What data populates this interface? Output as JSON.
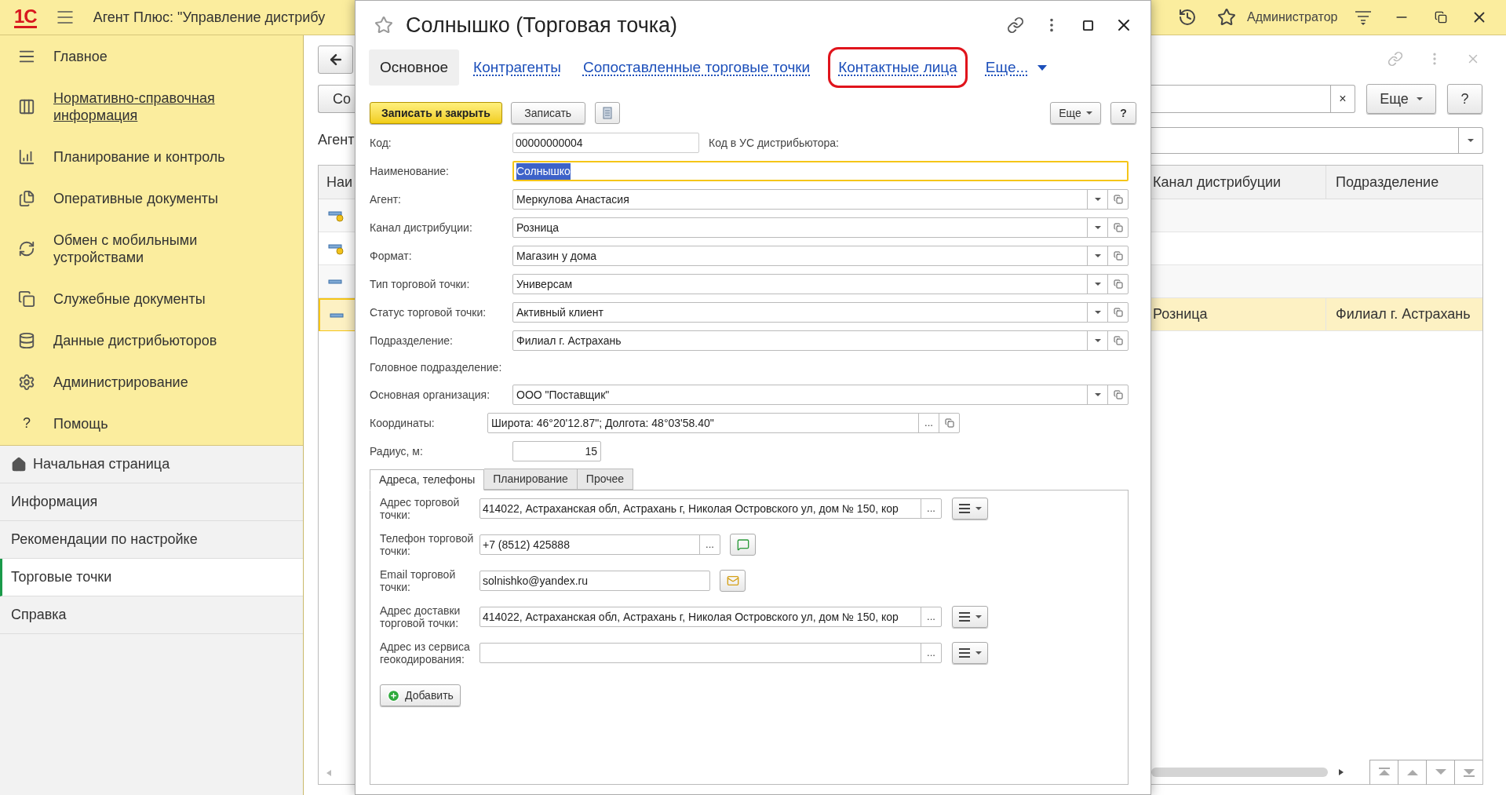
{
  "app": {
    "logo": "1С",
    "title": "Агент Плюс: \"Управление дистрибу",
    "user": "Администратор"
  },
  "sidebar": {
    "sections": [
      {
        "label": "Главное",
        "hovered": false
      },
      {
        "label": "Нормативно-справочная информация",
        "hovered": true
      },
      {
        "label": "Планирование и контроль",
        "hovered": false
      },
      {
        "label": "Оперативные документы",
        "hovered": false
      },
      {
        "label": "Обмен с мобильными устройствами",
        "hovered": false
      },
      {
        "label": "Служебные документы",
        "hovered": false
      },
      {
        "label": "Данные дистрибьюторов",
        "hovered": false
      },
      {
        "label": "Администрирование",
        "hovered": false
      },
      {
        "label": "Помощь",
        "hovered": false,
        "glyph": "?"
      }
    ],
    "items": [
      {
        "kind": "home",
        "label": "Начальная страница",
        "selected": false
      },
      {
        "kind": "page",
        "label": "Информация",
        "selected": false
      },
      {
        "kind": "page",
        "label": "Рекомендации по настройке",
        "selected": false
      },
      {
        "kind": "page",
        "label": "Торговые точки",
        "selected": true
      },
      {
        "kind": "page",
        "label": "Справка",
        "selected": false
      }
    ]
  },
  "list": {
    "create_button": "Со",
    "agent_label": "Агент",
    "search_clear": "×",
    "more_button": "Еще",
    "help_button": "?",
    "columns": [
      "Наи",
      "Канал дистрибуции",
      "Подразделение"
    ],
    "rows": [
      {
        "kind": "marked",
        "selected": false
      },
      {
        "kind": "marked",
        "selected": false
      },
      {
        "kind": "plain",
        "selected": false
      },
      {
        "kind": "plain",
        "selected": true,
        "cells": [
          "Розница",
          "Филиал г. Астрахань"
        ]
      }
    ]
  },
  "form": {
    "title": "Солнышко (Торговая точка)",
    "nav": [
      {
        "label": "Основное",
        "selected": true,
        "highlighted": false
      },
      {
        "label": "Контрагенты",
        "selected": false,
        "highlighted": false
      },
      {
        "label": "Сопоставленные торговые точки",
        "selected": false,
        "highlighted": false
      },
      {
        "label": "Контактные лица",
        "selected": false,
        "highlighted": true
      },
      {
        "label": "Еще...",
        "selected": false,
        "highlighted": false
      }
    ],
    "commands": {
      "primary": "Записать и закрыть",
      "save": "Записать",
      "more": "Еще",
      "help": "?"
    },
    "fields": [
      {
        "kind": "code",
        "label": "Код:",
        "value": "00000000004",
        "side_label": "Код в УС дистрибьютора:",
        "focused": false
      },
      {
        "kind": "text",
        "label": "Наименование:",
        "value": "Солнышко",
        "focused": true
      },
      {
        "kind": "select",
        "label": "Агент:",
        "value": "Меркулова Анастасия"
      },
      {
        "kind": "select",
        "label": "Канал дистрибуции:",
        "value": "Розница"
      },
      {
        "kind": "select",
        "label": "Формат:",
        "value": "Магазин у дома"
      },
      {
        "kind": "select",
        "label": "Тип торговой точки:",
        "value": "Универсам"
      },
      {
        "kind": "select",
        "label": "Статус торговой точки:",
        "value": "Активный клиент"
      },
      {
        "kind": "select",
        "label": "Подразделение:",
        "value": "Филиал г. Астрахань"
      },
      {
        "kind": "heading",
        "label": "Головное подразделение:"
      },
      {
        "kind": "select",
        "label": "Основная организация:",
        "value": "ООО \"Поставщик\""
      },
      {
        "kind": "picker",
        "label": "Координаты:",
        "value": "Широта: 46°20'12.87\"; Долгота: 48°03'58.40\"",
        "button": "..."
      },
      {
        "kind": "number",
        "label": "Радиус, м:",
        "value": "15"
      }
    ],
    "subtabs": [
      {
        "label": "Адреса, телефоны",
        "selected": true
      },
      {
        "label": "Планирование",
        "selected": false
      },
      {
        "label": "Прочее",
        "selected": false
      }
    ],
    "contacts": [
      {
        "kind": "address",
        "label": "Адрес торговой точки:",
        "value": "414022, Астраханская обл, Астрахань г, Николая Островского ул, дом № 150, кор",
        "button": "..."
      },
      {
        "kind": "phone",
        "label": "Телефон торговой точки:",
        "value": "+7 (8512) 425888",
        "button": "..."
      },
      {
        "kind": "email",
        "label": "Email торговой точки:",
        "value": "solnishko@yandex.ru"
      },
      {
        "kind": "address",
        "label": "Адрес доставки торговой точки:",
        "value": "414022, Астраханская обл, Астрахань г, Николая Островского ул, дом № 150, кор",
        "button": "..."
      },
      {
        "kind": "address",
        "label": "Адрес из сервиса геокодирования:",
        "button": "..."
      }
    ],
    "add_button": "Добавить"
  }
}
